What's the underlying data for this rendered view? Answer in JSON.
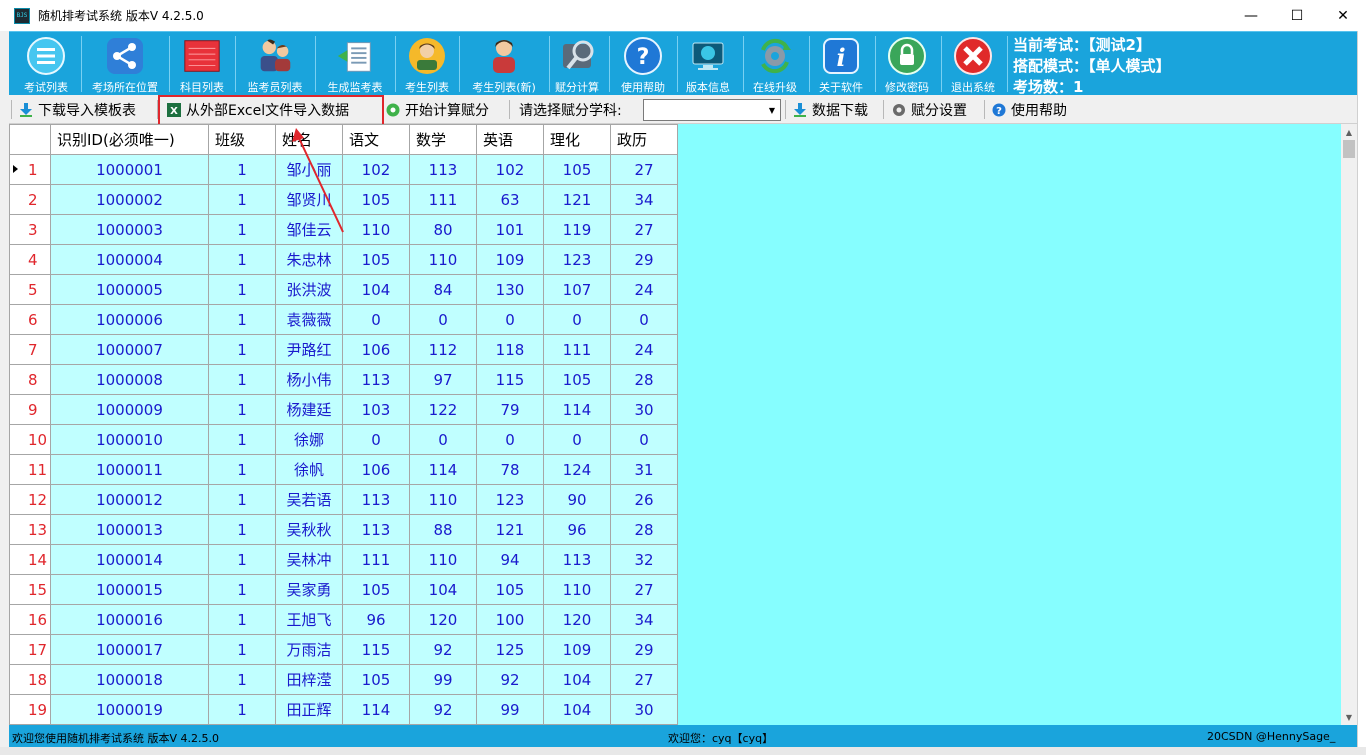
{
  "window": {
    "title": "随机排考试系统  版本V 4.2.5.0",
    "app_icon_text": "BJS",
    "minimize": "—",
    "maximize": "☐",
    "close": "✕"
  },
  "ribbon": {
    "items": [
      {
        "label": "考试列表",
        "icon": "list-icon"
      },
      {
        "label": "考场所在位置",
        "icon": "share-icon"
      },
      {
        "label": "科目列表",
        "icon": "book-icon"
      },
      {
        "label": "监考员列表",
        "icon": "people-icon"
      },
      {
        "label": "生成监考表",
        "icon": "document-icon"
      },
      {
        "label": "考生列表",
        "icon": "student-icon"
      },
      {
        "label": "考生列表(新)",
        "icon": "student-new-icon"
      },
      {
        "label": "赋分计算",
        "icon": "calculator-icon"
      },
      {
        "label": "使用帮助",
        "icon": "help-icon"
      },
      {
        "label": "版本信息",
        "icon": "monitor-icon"
      },
      {
        "label": "在线升级",
        "icon": "refresh-icon"
      },
      {
        "label": "关于软件",
        "icon": "info-icon"
      },
      {
        "label": "修改密码",
        "icon": "lock-icon"
      },
      {
        "label": "退出系统",
        "icon": "exit-icon"
      }
    ],
    "exam_info": {
      "current_exam": "当前考试：【测试2】",
      "mode": "搭配模式：【单人模式】",
      "room_count": "考场数：1"
    }
  },
  "toolbar": {
    "download_template": "下载导入模板表",
    "import_excel": "从外部Excel文件导入数据",
    "start_calc": "开始计算赋分",
    "select_subject_label": "请选择赋分学科:",
    "select_value": "",
    "data_download": "数据下载",
    "score_settings": "赋分设置",
    "help": "使用帮助"
  },
  "grid": {
    "columns": [
      "识别ID(必须唯一)",
      "班级",
      "姓名",
      "语文",
      "数学",
      "英语",
      "理化",
      "政历"
    ],
    "rows": [
      {
        "n": "1",
        "cells": [
          "1000001",
          "1",
          "邹小丽",
          "102",
          "113",
          "102",
          "105",
          "27"
        ]
      },
      {
        "n": "2",
        "cells": [
          "1000002",
          "1",
          "邹贤川",
          "105",
          "111",
          "63",
          "121",
          "34"
        ]
      },
      {
        "n": "3",
        "cells": [
          "1000003",
          "1",
          "邹佳云",
          "110",
          "80",
          "101",
          "119",
          "27"
        ]
      },
      {
        "n": "4",
        "cells": [
          "1000004",
          "1",
          "朱忠林",
          "105",
          "110",
          "109",
          "123",
          "29"
        ]
      },
      {
        "n": "5",
        "cells": [
          "1000005",
          "1",
          "张洪波",
          "104",
          "84",
          "130",
          "107",
          "24"
        ]
      },
      {
        "n": "6",
        "cells": [
          "1000006",
          "1",
          "袁薇薇",
          "0",
          "0",
          "0",
          "0",
          "0"
        ]
      },
      {
        "n": "7",
        "cells": [
          "1000007",
          "1",
          "尹路红",
          "106",
          "112",
          "118",
          "111",
          "24"
        ]
      },
      {
        "n": "8",
        "cells": [
          "1000008",
          "1",
          "杨小伟",
          "113",
          "97",
          "115",
          "105",
          "28"
        ]
      },
      {
        "n": "9",
        "cells": [
          "1000009",
          "1",
          "杨建廷",
          "103",
          "122",
          "79",
          "114",
          "30"
        ]
      },
      {
        "n": "10",
        "cells": [
          "1000010",
          "1",
          "徐娜",
          "0",
          "0",
          "0",
          "0",
          "0"
        ]
      },
      {
        "n": "11",
        "cells": [
          "1000011",
          "1",
          "徐帆",
          "106",
          "114",
          "78",
          "124",
          "31"
        ]
      },
      {
        "n": "12",
        "cells": [
          "1000012",
          "1",
          "吴若语",
          "113",
          "110",
          "123",
          "90",
          "26"
        ]
      },
      {
        "n": "13",
        "cells": [
          "1000013",
          "1",
          "吴秋秋",
          "113",
          "88",
          "121",
          "96",
          "28"
        ]
      },
      {
        "n": "14",
        "cells": [
          "1000014",
          "1",
          "吴林冲",
          "111",
          "110",
          "94",
          "113",
          "32"
        ]
      },
      {
        "n": "15",
        "cells": [
          "1000015",
          "1",
          "吴家勇",
          "105",
          "104",
          "105",
          "110",
          "27"
        ]
      },
      {
        "n": "16",
        "cells": [
          "1000016",
          "1",
          "王旭飞",
          "96",
          "120",
          "100",
          "120",
          "34"
        ]
      },
      {
        "n": "17",
        "cells": [
          "1000017",
          "1",
          "万雨洁",
          "115",
          "92",
          "125",
          "109",
          "29"
        ]
      },
      {
        "n": "18",
        "cells": [
          "1000018",
          "1",
          "田梓滢",
          "105",
          "99",
          "92",
          "104",
          "27"
        ]
      },
      {
        "n": "19",
        "cells": [
          "1000019",
          "1",
          "田正辉",
          "114",
          "92",
          "99",
          "104",
          "30"
        ]
      }
    ]
  },
  "statusbar": {
    "welcome_system": "欢迎您使用随机排考试系统  版本V 4.2.5.0",
    "welcome_user": "欢迎您：cyq【cyq】",
    "watermark": "20CSDN @HennySage_"
  },
  "colors": {
    "ribbon_bg": "#1aa4dc",
    "grid_bg": "#86feff",
    "cell_bg": "#c0ffff",
    "cell_text": "#1a1acd",
    "row_num": "#e0262c",
    "highlight": "#e0262c"
  }
}
